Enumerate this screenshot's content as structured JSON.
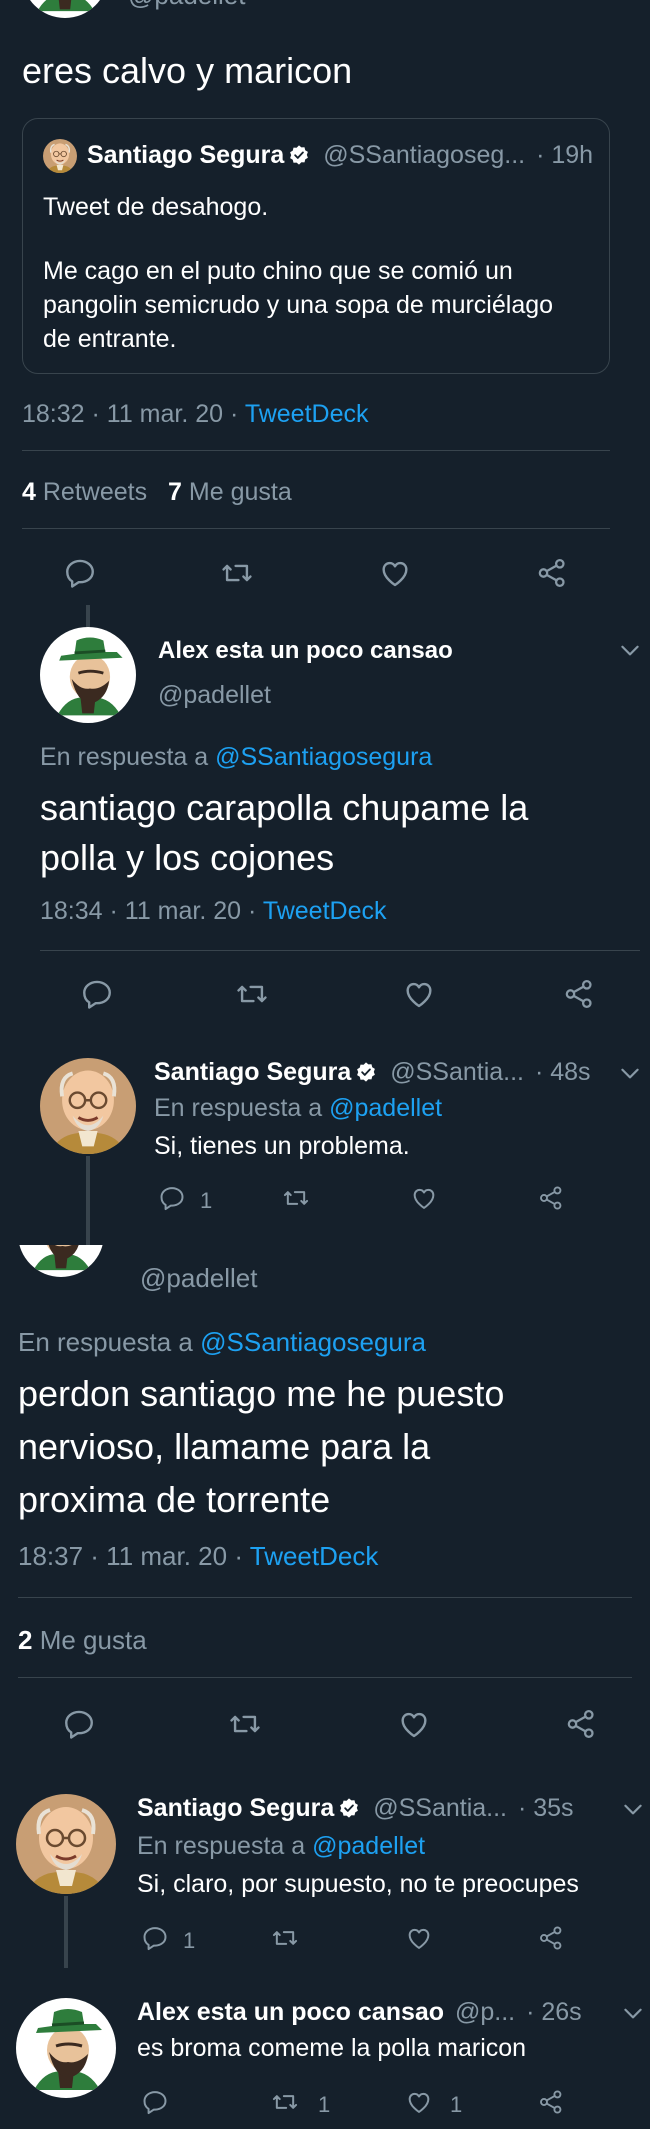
{
  "colors": {
    "background": "#15202b",
    "text": "#ffffff",
    "secondary": "#8899a6",
    "link": "#1da1f2",
    "divider": "#38444d"
  },
  "s1": {
    "top_handle": "@padellet",
    "tweet_text": "eres calvo y maricon",
    "quote": {
      "name": "Santiago Segura",
      "handle": "@SSantiagoseg...",
      "time": "· 19h",
      "line1": "Tweet de desahogo.",
      "line2": "Me cago en el puto chino que se comió un",
      "line3": "pangolin semicrudo y una sopa de murciélago",
      "line4": "de entrante."
    },
    "timestamp": "18:32 · 11 mar. 20 ·",
    "source": "TweetDeck",
    "retweets_count": "4",
    "retweets_label": "Retweets",
    "likes_count": "7",
    "likes_label": "Me gusta",
    "icons": [
      "reply-icon",
      "retweet-icon",
      "like-icon",
      "share-icon"
    ]
  },
  "s2": {
    "name": "Alex esta un poco cansao",
    "handle": "@padellet",
    "reply_prefix": "En respuesta a",
    "reply_to": "@SSantiagosegura",
    "text_line1": "santiago carapolla chupame la",
    "text_line2": "polla y los cojones",
    "timestamp": "18:34 · 11 mar. 20 ·",
    "source": "TweetDeck"
  },
  "s3": {
    "name": "Santiago Segura",
    "handle": "@SSantia...",
    "time": "· 48s",
    "reply_prefix": "En respuesta a",
    "reply_to": "@padellet",
    "text": "Si, tienes un problema.",
    "reply_count": "1"
  },
  "s4": {
    "handle": "@padellet",
    "reply_prefix": "En respuesta a",
    "reply_to": "@SSantiagosegura",
    "text_line1": "perdon santiago me he puesto",
    "text_line2": "nervioso, llamame para la",
    "text_line3": "proxima de torrente",
    "timestamp": "18:37 · 11 mar. 20 ·",
    "source": "TweetDeck",
    "likes_count": "2",
    "likes_label": "Me gusta"
  },
  "s5": {
    "tweet1": {
      "name": "Santiago Segura",
      "handle": "@SSantia...",
      "time": "· 35s",
      "reply_prefix": "En respuesta a",
      "reply_to": "@padellet",
      "text": "Si, claro, por supuesto, no te preocupes",
      "reply_count": "1"
    },
    "tweet2": {
      "name": "Alex esta un poco cansao",
      "handle": "@p...",
      "time": "· 26s",
      "text": "es broma comeme la polla maricon",
      "retweet_count": "1",
      "like_count": "1"
    }
  }
}
